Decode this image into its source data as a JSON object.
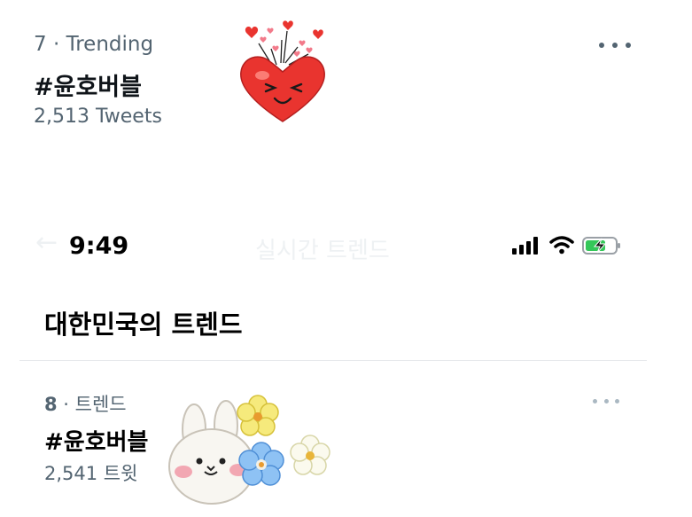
{
  "top_trend": {
    "meta": "7 · Trending",
    "hashtag": "#윤호버블",
    "count": "2,513 Tweets",
    "more_icon": "more-horizontal-icon"
  },
  "status_bar": {
    "time": "9:49",
    "back_icon": "back-arrow-icon",
    "faded_title": "실시간 트렌드",
    "icons": [
      "cellular-signal-icon",
      "wifi-icon",
      "battery-charging-icon"
    ]
  },
  "section": {
    "title": "대한민국의 트렌드"
  },
  "bottom_trend": {
    "rank": "8",
    "meta_label": " · 트렌드",
    "hashtag": "#윤호버블",
    "count": "2,541 트윗",
    "more_icon": "more-horizontal-icon"
  },
  "colors": {
    "muted": "#536471",
    "battery_green": "#34c759",
    "heart_red": "#e9342f"
  }
}
